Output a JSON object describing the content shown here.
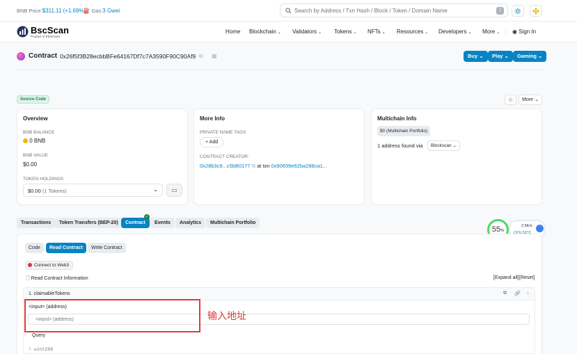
{
  "topbar": {
    "price_label": "BNB Price:",
    "price_value": "$311.11 (+1.69%)",
    "gas_label": "Gas:",
    "gas_value": "3 Gwei",
    "search_placeholder": "Search by Address / Txn Hash / Block / Token / Domain Name",
    "search_shortcut": "/"
  },
  "logo": {
    "name": "BscScan",
    "subtitle": "Product of Etherscan"
  },
  "nav": {
    "items": [
      {
        "label": "Home"
      },
      {
        "label": "Blockchain"
      },
      {
        "label": "Validators"
      },
      {
        "label": "Tokens"
      },
      {
        "label": "NFTs"
      },
      {
        "label": "Resources"
      },
      {
        "label": "Developers"
      },
      {
        "label": "More"
      }
    ],
    "signin": "Sign In"
  },
  "contract": {
    "title": "Contract",
    "address": "0x26f5f3B28ecbbBFe64167Df7c7A3590F90C90Af9",
    "buttons": [
      "Buy",
      "Play",
      "Gaming"
    ]
  },
  "source_badge": "Source Code",
  "more_button": "More",
  "overview": {
    "title": "Overview",
    "balance_label": "BNB BALANCE",
    "balance_value": "0 BNB",
    "value_label": "BNB VALUE",
    "value_value": "$0.00",
    "holdings_label": "TOKEN HOLDINGS",
    "holdings_value": "$0.00",
    "holdings_count": "(1 Tokens)"
  },
  "more_info": {
    "title": "More Info",
    "tags_label": "PRIVATE NAME TAGS",
    "add_label": "+ Add",
    "creator_label": "CONTRACT CREATOR:",
    "creator_address": "0x28b3c9...c5bB0177",
    "at_txn": "at txn",
    "txn_hash": "0x90659e62ba288ca1..."
  },
  "multichain": {
    "title": "Multichain Info",
    "portfolio_badge": "$0 (Multichain Portfolio)",
    "found_text": "1 address found via",
    "blockscan": "Blockscan"
  },
  "tabs": [
    "Transactions",
    "Token Transfers (BEP-20)",
    "Contract",
    "Events",
    "Analytics",
    "Multichain Portfolio"
  ],
  "subtabs": [
    "Code",
    "Read Contract",
    "Write Contract"
  ],
  "connect_web3": "Connect to Web3",
  "read_info": "Read Contract Information",
  "expand_all": "[Expand all]",
  "reset": "[Reset]",
  "function": {
    "name": "1. claimableTokens",
    "param_label": "<input> (address)",
    "param_placeholder": "<input> (address)",
    "query": "Query",
    "return_type": "uint256"
  },
  "annotation": "输入地址",
  "widget": {
    "percent": "55",
    "unit": "%",
    "net": "2.5K/s",
    "cpu_label": "CPU",
    "cpu_temp": "53°C"
  },
  "colors": {
    "accent": "#0784c3",
    "annotation": "#e53935",
    "ring": "#4cd964"
  }
}
